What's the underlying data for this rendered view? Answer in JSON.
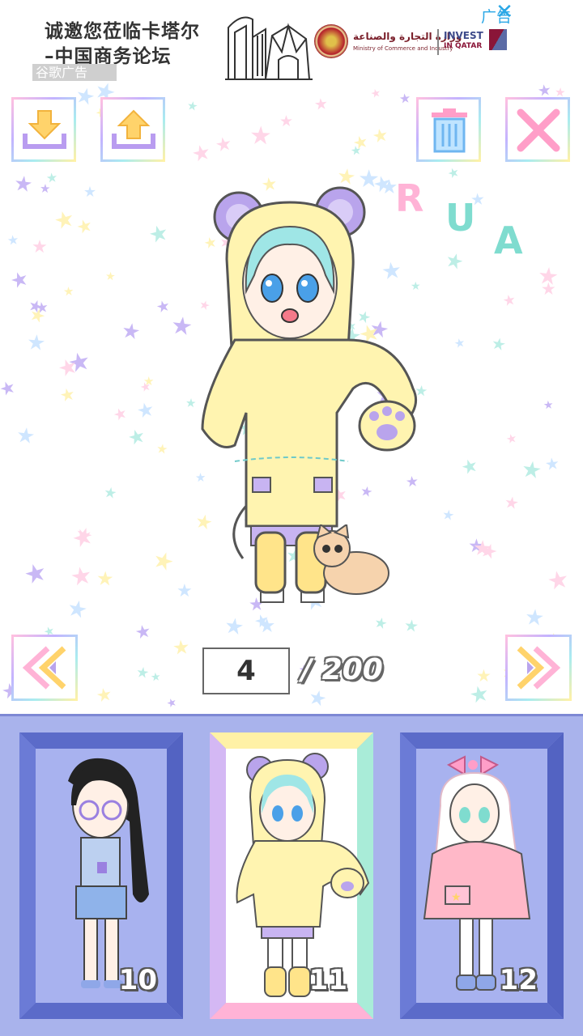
{
  "ad": {
    "line1": "诚邀您莅临卡塔尔",
    "line2": "–中国商务论坛",
    "google_label": "谷歌广告",
    "ad_label": "广告",
    "close_glyph": "✕",
    "arabic": "وزارة التجارة والصناعة",
    "arabic_sub": "Ministry of Commerce and Industry",
    "invest": "INVEST",
    "invest_sub": "IN QATAR"
  },
  "toolbar": {
    "download_icon": "download-tray-icon",
    "upload_icon": "upload-tray-icon",
    "delete_icon": "trash-icon",
    "close_icon": "close-x-icon"
  },
  "stage": {
    "title_letters": [
      "R",
      "U",
      "A"
    ],
    "title_colors": [
      "#ffb3d6",
      "#7fdccf",
      "#7fdccf"
    ]
  },
  "pager": {
    "current": "4",
    "total": "/ 200",
    "prev_icon": "double-chevron-left-icon",
    "next_icon": "double-chevron-right-icon"
  },
  "slots": [
    {
      "number": "10",
      "character": "dark-hair-glasses-denim-shorts"
    },
    {
      "number": "11",
      "character": "yellow-bear-hoodie"
    },
    {
      "number": "12",
      "character": "pink-bow-pink-cape"
    }
  ],
  "colors": {
    "tray_bg": "#a9b3ec",
    "slot_frame": "#5b6bc9",
    "accent_pink": "#ffb3d6",
    "accent_mint": "#7fdccf",
    "accent_purple": "#c3a6f2",
    "accent_yellow": "#fff1a6"
  }
}
